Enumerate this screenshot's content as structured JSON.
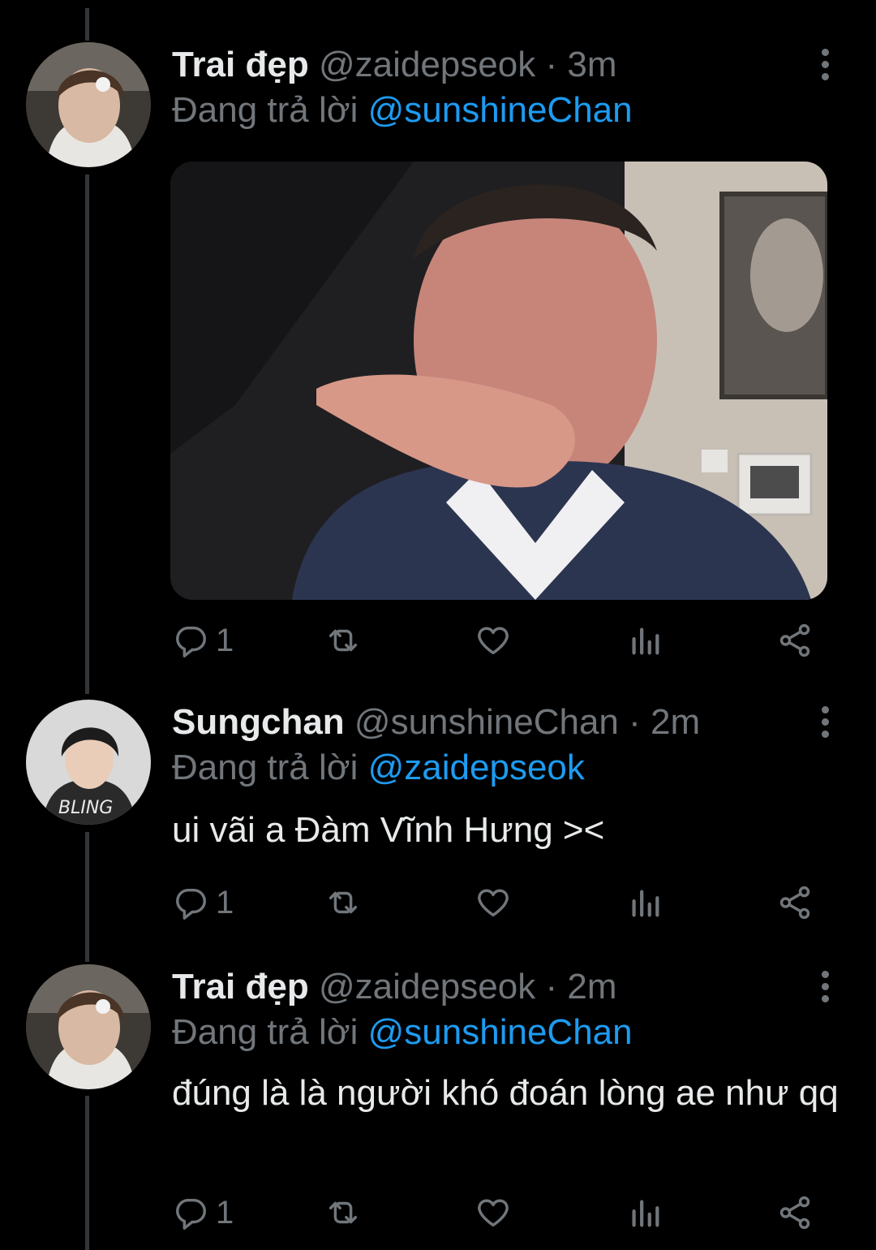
{
  "tweets": [
    {
      "name": "Trai đẹp",
      "handle": "@zaidepseok",
      "sep": "·",
      "time": "3m",
      "reply_prefix": "Đang trả lời",
      "reply_to": "@sunshineChan",
      "text": "",
      "reply_count": "1"
    },
    {
      "name": "Sungchan",
      "handle": "@sunshineChan",
      "sep": "·",
      "time": "2m",
      "reply_prefix": "Đang trả lời",
      "reply_to": "@zaidepseok",
      "text": "ui vãi a Đàm Vĩnh Hưng ><",
      "reply_count": "1"
    },
    {
      "name": "Trai đẹp",
      "handle": "@zaidepseok",
      "sep": "·",
      "time": "2m",
      "reply_prefix": "Đang trả lời",
      "reply_to": "@sunshineChan",
      "text": "đúng là là người khó đoán lòng ae như qq",
      "reply_count": "1"
    }
  ],
  "colors": {
    "background": "#000000",
    "accent": "#1d9bf0",
    "muted": "#71767b",
    "text": "#e7e9ea"
  },
  "icons": [
    "reply-icon",
    "retweet-icon",
    "like-icon",
    "views-icon",
    "share-icon",
    "more-icon"
  ]
}
